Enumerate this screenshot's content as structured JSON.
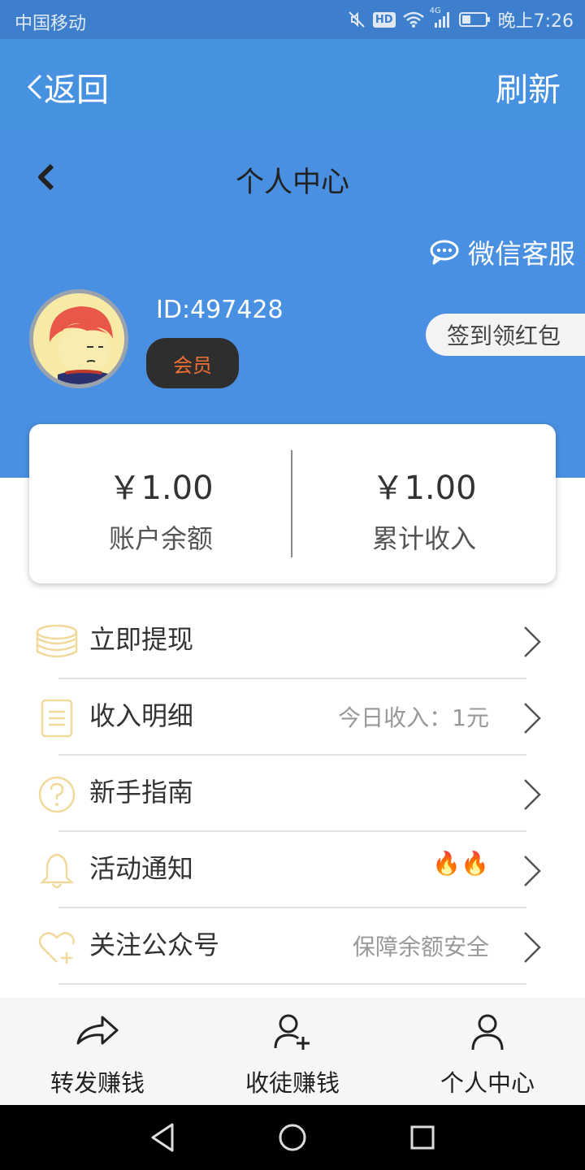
{
  "status_bar": {
    "carrier": "中国移动",
    "network_tag": "HD",
    "signal_tag": "4G",
    "time": "晚上7:26",
    "icons": [
      "mute-icon",
      "wifi-icon",
      "signal-icon",
      "battery-icon"
    ]
  },
  "title_bar": {
    "back_label": "返回",
    "refresh_label": "刷新"
  },
  "header": {
    "title": "个人中心",
    "wechat_service": "微信客服",
    "user_id": "ID:497428",
    "member_badge": "会员",
    "sign_in": "签到领红包"
  },
  "balance": {
    "account_amount": "￥1.00",
    "account_label": "账户余额",
    "total_amount": "￥1.00",
    "total_label": "累计收入"
  },
  "menu": {
    "items": [
      {
        "label": "立即提现",
        "extra": "",
        "icon": "coins-icon"
      },
      {
        "label": "收入明细",
        "extra": "今日收入：1元",
        "icon": "notepad-icon"
      },
      {
        "label": "新手指南",
        "extra": "",
        "icon": "question-icon"
      },
      {
        "label": "活动通知",
        "extra": "🔥🔥",
        "icon": "bell-icon"
      },
      {
        "label": "关注公众号",
        "extra": "保障余额安全",
        "icon": "heart-plus-icon"
      }
    ]
  },
  "tabs": [
    {
      "label": "转发赚钱",
      "icon": "share-arrow-icon"
    },
    {
      "label": "收徒赚钱",
      "icon": "add-user-icon"
    },
    {
      "label": "个人中心",
      "icon": "user-icon"
    }
  ],
  "colors": {
    "primary_blue": "#4a90e2",
    "status_bar_blue": "#3d7fcc",
    "badge_dark": "#2e2e2e",
    "badge_text": "#f07033",
    "menu_icon_tint": "#f0d99a"
  }
}
